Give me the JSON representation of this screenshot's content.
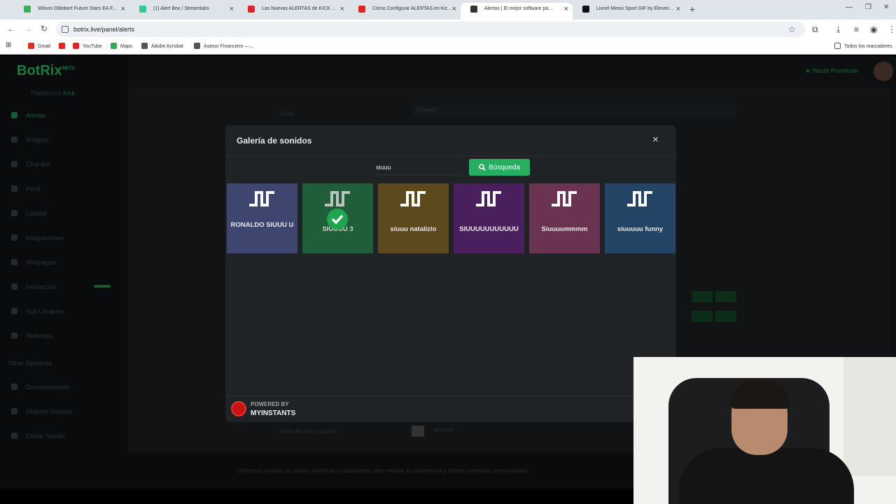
{
  "browser": {
    "tabs": [
      {
        "title": "Wilson Oldobert Future Stars EA F...",
        "color": "#3fae5a"
      },
      {
        "title": "(1) Alert Box / Streamlabs",
        "color": "#2fc98b"
      },
      {
        "title": "Las Nuevas ALERTAS de KICK ...",
        "color": "#e02424"
      },
      {
        "title": "Cómo Configurar ALERTAS en Kic...",
        "color": "#e02424"
      },
      {
        "title": "Alertas | El mejor software pa...",
        "color": "#333333"
      },
      {
        "title": "Lionel Messi Sport GIF by Eleven...",
        "color": "#111111"
      }
    ],
    "url": "botrix.live/panel/alerts",
    "bookmarks": [
      {
        "label": "Gmail",
        "color": "#d93025"
      },
      {
        "label": "YouTube",
        "color": "#e02424"
      },
      {
        "label": "YouTube",
        "color": "#e02424"
      },
      {
        "label": "Maps",
        "color": "#34a853"
      },
      {
        "label": "Adobe Acrobat",
        "color": "#555555"
      },
      {
        "label": "Asesor Financiero —...",
        "color": "#555555"
      }
    ],
    "all_bookmarks": "Todos los marcadores"
  },
  "app": {
    "logo": "BotRix",
    "logo_tag": "BETA",
    "platform_label": "Plataforma",
    "platform_value": "Kick",
    "premium": "Hazte Premium",
    "sidebar": [
      "Alertas",
      "Widgets",
      "Chat Bot",
      "Perfil",
      "Lealtad",
      "Integraciones",
      "Minijuegos",
      "Interacción",
      "Sub Usuarios",
      "Referidos"
    ],
    "section_other": "Otras Opciones",
    "sidebar_other": [
      "Documentación",
      "Obtener Soporte",
      "Cerrar Sesión"
    ],
    "bg_style_label": "Estilo",
    "bg_style_value": "Compact",
    "bg_text_color_label": "Color de texto superior",
    "bg_text_color_value": "#FFFFFF",
    "cookie_text": "Utilizamos cookies de sesión, analíticas y publicitarias para mejorar su experiencia y ofrecer contenido personalizado."
  },
  "modal": {
    "title": "Galería de sonidos",
    "close": "×",
    "search_value": "siuuu",
    "search_button": "Búsqueda",
    "sounds": [
      {
        "label": "RONALDO SIUUU U",
        "color": "#3e4670",
        "selected": false
      },
      {
        "label": "SIUUUU 3",
        "color": "#1f5e38",
        "selected": true
      },
      {
        "label": "siuuu natalizio",
        "color": "#5c4a1e",
        "selected": false
      },
      {
        "label": "SIUUUUUUUUUUU",
        "color": "#4a1f5e",
        "selected": false
      },
      {
        "label": "Siuuuummmm",
        "color": "#6b3352",
        "selected": false
      },
      {
        "label": "siuuuuu funny",
        "color": "#244466",
        "selected": false
      }
    ],
    "powered_by": "POWERED BY",
    "brand": "MYINSTANTS"
  }
}
